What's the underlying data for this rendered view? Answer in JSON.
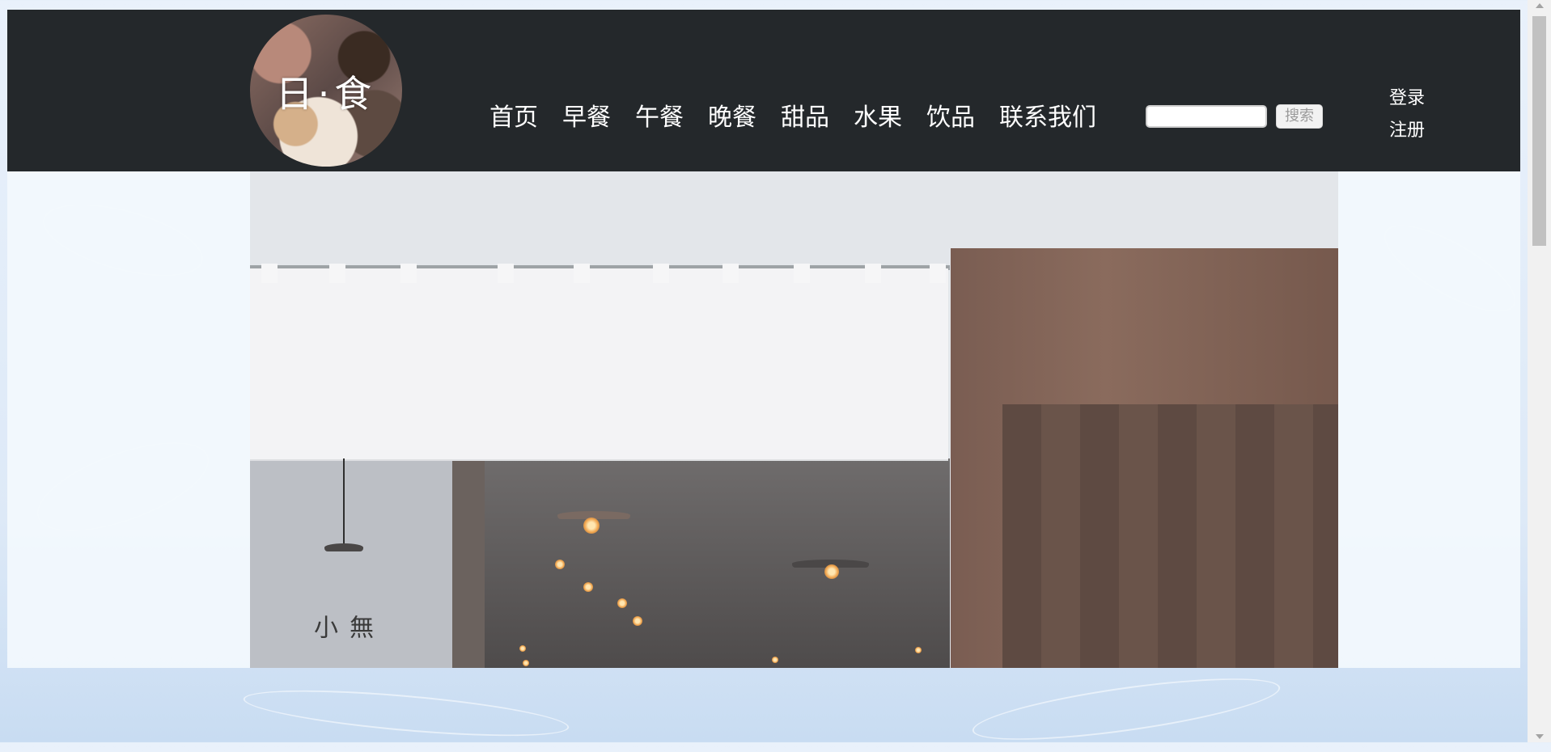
{
  "brand": {
    "logo_text": "日·食"
  },
  "nav": {
    "items": [
      {
        "label": "首页"
      },
      {
        "label": "早餐"
      },
      {
        "label": "午餐"
      },
      {
        "label": "晚餐"
      },
      {
        "label": "甜品"
      },
      {
        "label": "水果"
      },
      {
        "label": "饮品"
      },
      {
        "label": "联系我们"
      }
    ]
  },
  "search": {
    "value": "",
    "button_label": "搜索"
  },
  "auth": {
    "login_label": "登录",
    "register_label": "注册"
  },
  "hero": {
    "sign_text": "無小"
  },
  "colors": {
    "topbar": "#24282b",
    "accent_text": "#ffffff"
  }
}
